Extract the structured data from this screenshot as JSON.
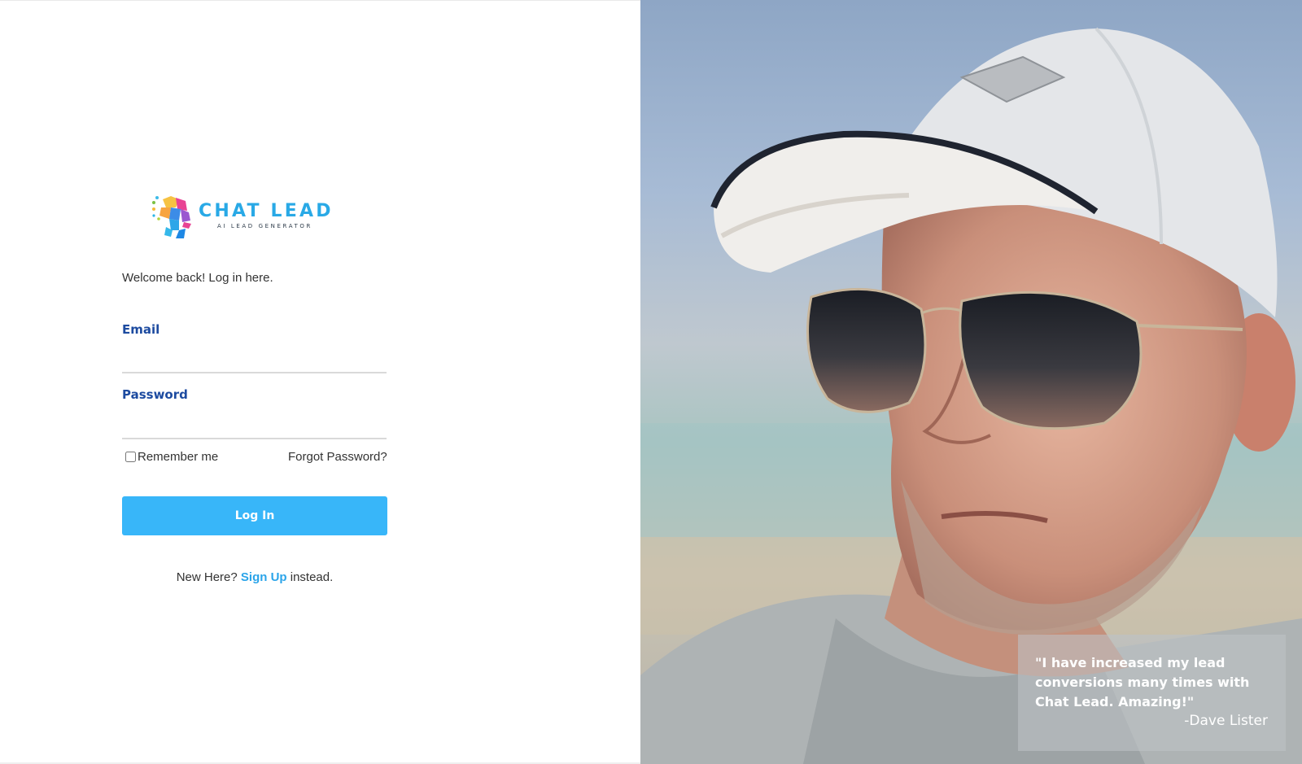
{
  "brand": {
    "name": "CHAT LEAD",
    "tagline": "AI LEAD GENERATOR"
  },
  "login": {
    "welcome": "Welcome back! Log in here.",
    "email_label": "Email",
    "email_value": "",
    "password_label": "Password",
    "password_value": "",
    "remember_label": "Remember me",
    "remember_checked": false,
    "forgot_label": "Forgot Password?",
    "submit_label": "Log In",
    "signup_prefix": "New Here?",
    "signup_link": "Sign Up",
    "signup_suffix": "instead."
  },
  "testimonial": {
    "quote": "\"I have increased my lead conversions many times with Chat Lead. Amazing!\"",
    "author": "-Dave Lister"
  },
  "colors": {
    "primary": "#38b6f9",
    "label": "#1d4ba0",
    "link": "#2aa4e9",
    "brand": "#29a9e6"
  },
  "icons": {
    "logo": "colorful-head-logo-icon"
  }
}
